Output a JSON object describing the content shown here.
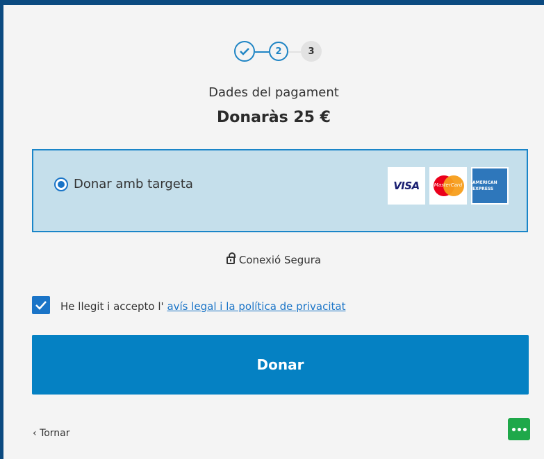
{
  "steps": [
    {
      "label": "✓",
      "state": "done"
    },
    {
      "label": "2",
      "state": "current"
    },
    {
      "label": "3",
      "state": "pending"
    }
  ],
  "header": {
    "subtitle": "Dades del pagament",
    "amount": "Donaràs 25 €"
  },
  "payment": {
    "option_label": "Donar amb targeta",
    "selected": true,
    "cards": [
      "VISA",
      "MasterCard",
      "AMERICAN EXPRESS"
    ]
  },
  "secure": {
    "icon": "lock-icon",
    "label": "Conexió Segura"
  },
  "terms": {
    "checked": true,
    "text": "He llegit i accepto l' ",
    "link": "avís legal i la política de privacitat"
  },
  "donate_button": "Donar",
  "back_link": "Tornar",
  "colors": {
    "accent": "#0581c3",
    "frame": "#0b4a80",
    "selected_bg": "#c5dfeb",
    "chat_button": "#1fa84a"
  }
}
